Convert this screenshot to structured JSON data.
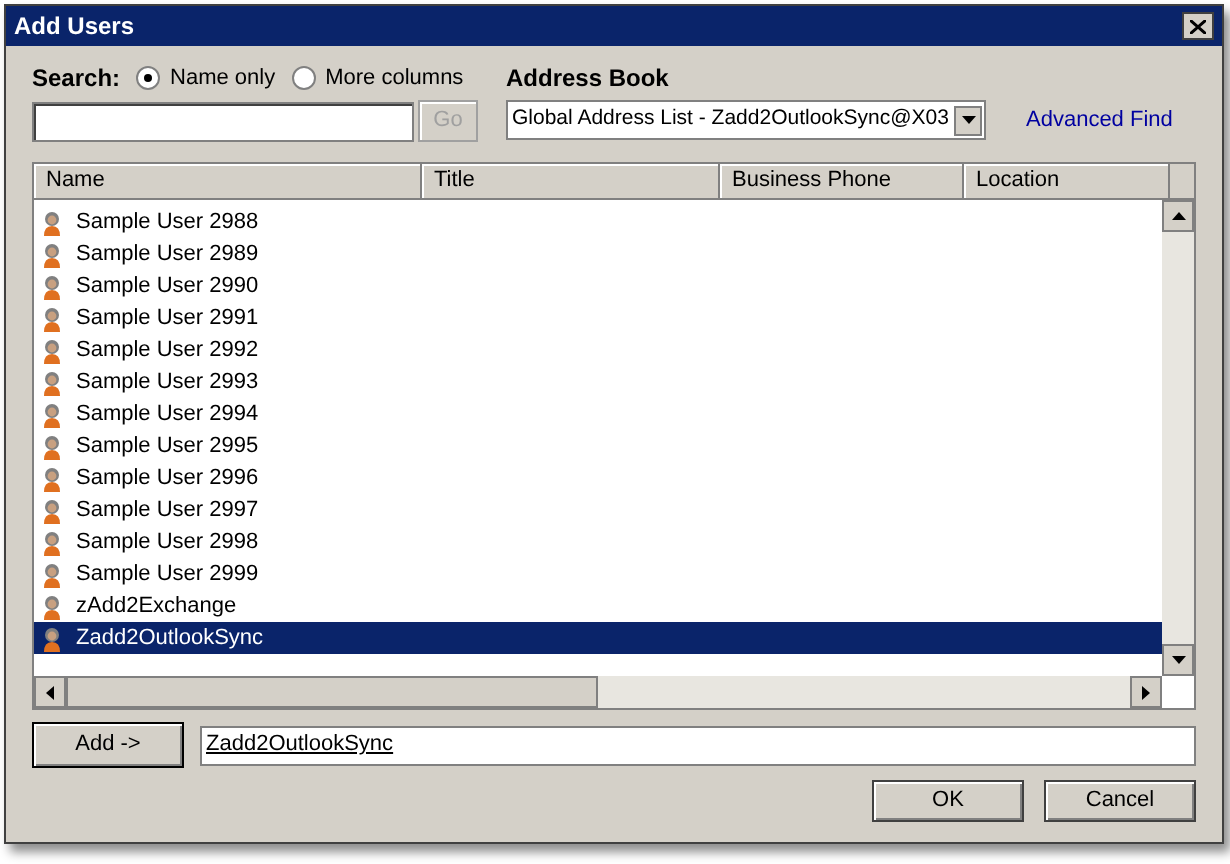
{
  "window": {
    "title": "Add Users"
  },
  "search": {
    "label": "Search:",
    "options": [
      {
        "label": "Name only",
        "selected": true
      },
      {
        "label": "More columns",
        "selected": false
      }
    ],
    "go": "Go"
  },
  "address_book": {
    "label": "Address Book",
    "value": "Global Address List - Zadd2OutlookSync@X03"
  },
  "advanced_find": "Advanced Find",
  "table": {
    "columns": [
      "Name",
      "Title",
      "Business Phone",
      "Location"
    ],
    "rows": [
      {
        "name": "Sample User 2988",
        "selected": false
      },
      {
        "name": "Sample User 2989",
        "selected": false
      },
      {
        "name": "Sample User 2990",
        "selected": false
      },
      {
        "name": "Sample User 2991",
        "selected": false
      },
      {
        "name": "Sample User 2992",
        "selected": false
      },
      {
        "name": "Sample User 2993",
        "selected": false
      },
      {
        "name": "Sample User 2994",
        "selected": false
      },
      {
        "name": "Sample User 2995",
        "selected": false
      },
      {
        "name": "Sample User 2996",
        "selected": false
      },
      {
        "name": "Sample User 2997",
        "selected": false
      },
      {
        "name": "Sample User 2998",
        "selected": false
      },
      {
        "name": "Sample User 2999",
        "selected": false
      },
      {
        "name": "zAdd2Exchange",
        "selected": false
      },
      {
        "name": "Zadd2OutlookSync",
        "selected": true
      }
    ]
  },
  "add_button": "Add ->",
  "recipients": "Zadd2OutlookSync",
  "buttons": [
    "OK",
    "Cancel"
  ]
}
